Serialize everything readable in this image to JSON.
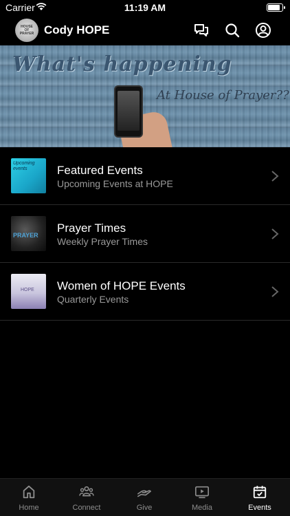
{
  "status_bar": {
    "carrier": "Carrier",
    "time": "11:19 AM",
    "battery_level": 0.95
  },
  "header": {
    "title": "Cody HOPE",
    "avatar_text": "HOUSE OF PRAYER"
  },
  "hero": {
    "title": "What's happening",
    "subtitle": "At House of Prayer??"
  },
  "events": [
    {
      "title": "Featured Events",
      "subtitle": "Upcoming Events at HOPE",
      "thumb_text": "Upcoming events"
    },
    {
      "title": "Prayer Times",
      "subtitle": "Weekly Prayer Times",
      "thumb_text": "PRAYER"
    },
    {
      "title": "Women of HOPE Events",
      "subtitle": "Quarterly Events",
      "thumb_text": "HOPE"
    }
  ],
  "tabs": [
    {
      "label": "Home",
      "icon": "home-icon"
    },
    {
      "label": "Connect",
      "icon": "people-icon"
    },
    {
      "label": "Give",
      "icon": "give-icon"
    },
    {
      "label": "Media",
      "icon": "media-icon"
    },
    {
      "label": "Events",
      "icon": "calendar-icon"
    }
  ],
  "active_tab": "Events"
}
